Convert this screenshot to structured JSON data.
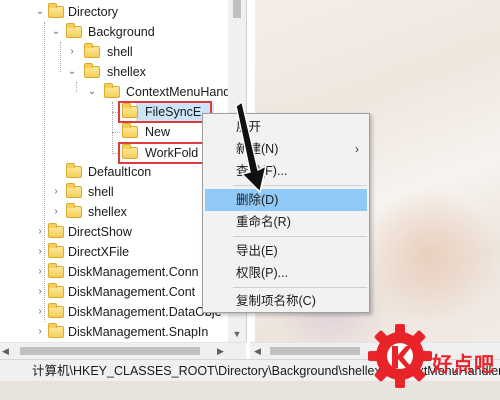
{
  "tree": {
    "items": [
      {
        "label": "Directory",
        "expanded": true
      },
      {
        "label": "Background",
        "expanded": true
      },
      {
        "label": "shell",
        "expanded": false
      },
      {
        "label": "shellex",
        "expanded": true
      },
      {
        "label": "ContextMenuHand",
        "expanded": true
      },
      {
        "label": "FileSyncE",
        "selected": true
      },
      {
        "label": "New"
      },
      {
        "label": "WorkFold"
      },
      {
        "label": "DefaultIcon"
      },
      {
        "label": "shell",
        "expanded": false
      },
      {
        "label": "shellex",
        "expanded": false
      },
      {
        "label": "DirectShow",
        "expanded": false
      },
      {
        "label": "DirectXFile",
        "expanded": false
      },
      {
        "label": "DiskManagement.Conn",
        "expanded": false
      },
      {
        "label": "DiskManagement.Cont",
        "expanded": false
      },
      {
        "label": "DiskManagement.DataObje",
        "expanded": false
      },
      {
        "label": "DiskManagement.SnapIn",
        "expanded": false
      }
    ]
  },
  "context_menu": {
    "items": [
      {
        "label": "展开"
      },
      {
        "label": "新建(N)",
        "submenu": "›"
      },
      {
        "label": "查找(F)..."
      },
      {
        "label": "删除(D)",
        "highlighted": true
      },
      {
        "label": "重命名(R)"
      },
      {
        "label": "导出(E)"
      },
      {
        "label": "权限(P)..."
      },
      {
        "label": "复制项名称(C)"
      }
    ]
  },
  "status_bar": {
    "path": "计算机\\HKEY_CLASSES_ROOT\\Directory\\Background\\shellex\\ContextMenuHandlers\\FileSyncEx"
  },
  "watermark": {
    "text": "好点吧"
  },
  "colors": {
    "selection_highlight": "#91c9f7",
    "annotation_red": "#e03a3a",
    "folder_yellow": "#f6cf5a"
  }
}
